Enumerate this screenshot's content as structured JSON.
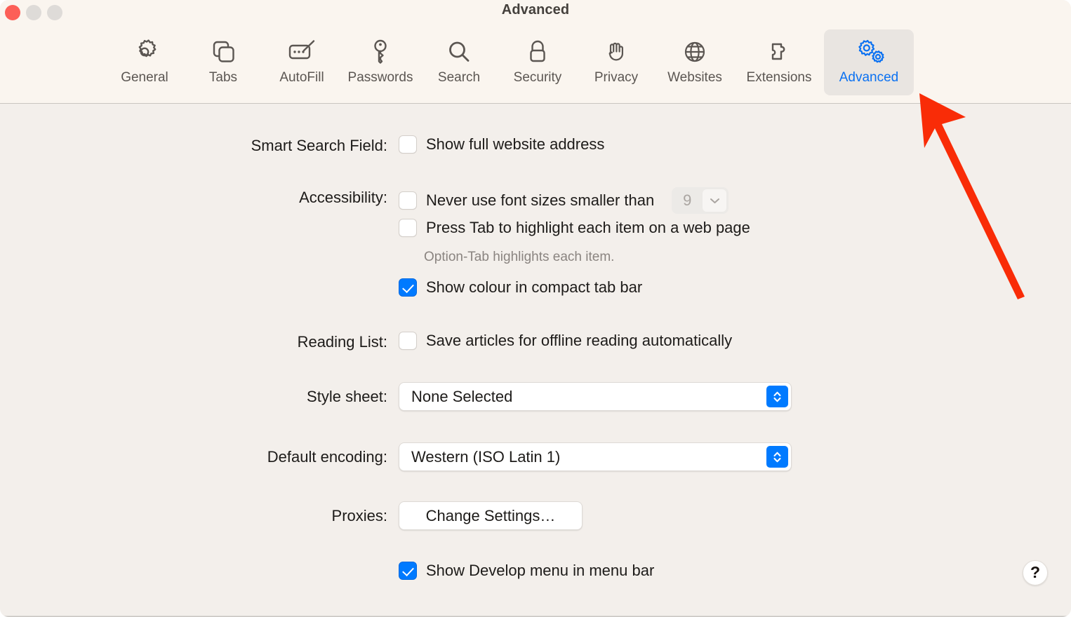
{
  "window": {
    "title": "Advanced",
    "traffic_lights": [
      {
        "name": "close",
        "color": "#fc5f57"
      },
      {
        "name": "minimize",
        "color": "#dedbd8"
      },
      {
        "name": "zoom",
        "color": "#dedbd8"
      }
    ]
  },
  "toolbar": {
    "selected_tab": "Advanced",
    "accent_color": "#0a71f2",
    "tabs": [
      {
        "label": "General",
        "icon": "gear-icon",
        "selected": false
      },
      {
        "label": "Tabs",
        "icon": "tabs-icon",
        "selected": false
      },
      {
        "label": "AutoFill",
        "icon": "autofill-icon",
        "selected": false
      },
      {
        "label": "Passwords",
        "icon": "key-icon",
        "selected": false
      },
      {
        "label": "Search",
        "icon": "search-icon",
        "selected": false
      },
      {
        "label": "Security",
        "icon": "lock-icon",
        "selected": false
      },
      {
        "label": "Privacy",
        "icon": "hand-icon",
        "selected": false
      },
      {
        "label": "Websites",
        "icon": "globe-icon",
        "selected": false
      },
      {
        "label": "Extensions",
        "icon": "puzzle-piece-icon",
        "selected": false
      },
      {
        "label": "Advanced",
        "icon": "double-gear-icon",
        "selected": true
      }
    ]
  },
  "settings": {
    "smart_search_field": {
      "label": "Smart Search Field:",
      "show_full_address": {
        "text": "Show full website address",
        "checked": false
      }
    },
    "accessibility": {
      "label": "Accessibility:",
      "min_font_size": {
        "text": "Never use font sizes smaller than",
        "checked": false,
        "value": "9",
        "enabled": false,
        "chevron_icon": "chevron-down-icon"
      },
      "press_tab": {
        "text": "Press Tab to highlight each item on a web page",
        "checked": false
      },
      "hint": "Option-Tab highlights each item.",
      "show_colour_compact_tab_bar": {
        "text": "Show colour in compact tab bar",
        "checked": true
      }
    },
    "reading_list": {
      "label": "Reading List:",
      "save_offline": {
        "text": "Save articles for offline reading automatically",
        "checked": false
      }
    },
    "style_sheet": {
      "label": "Style sheet:",
      "value": "None Selected"
    },
    "default_encoding": {
      "label": "Default encoding:",
      "value": "Western (ISO Latin 1)"
    },
    "proxies": {
      "label": "Proxies:",
      "button": "Change Settings…"
    },
    "develop_menu": {
      "text": "Show Develop menu in menu bar",
      "checked": true
    }
  },
  "help_button": {
    "glyph": "?"
  },
  "annotation": {
    "arrow_color": "#f92c07",
    "points_to": "Advanced"
  }
}
